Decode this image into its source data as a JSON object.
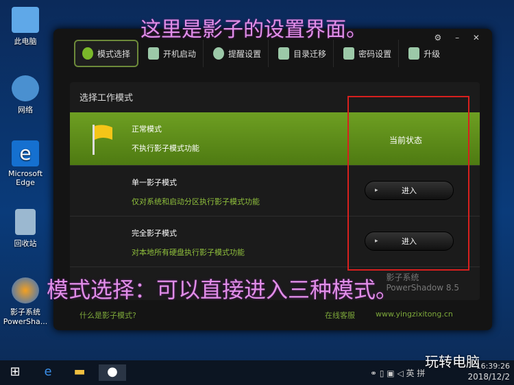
{
  "desktop": [
    {
      "label": "此电脑"
    },
    {
      "label": "网络"
    },
    {
      "label": "Microsoft Edge"
    },
    {
      "label": "回收站"
    },
    {
      "label": "影子系统 PowerSha..."
    }
  ],
  "annotations": {
    "top": "这里是影子的设置界面。",
    "middle": "模式选择：可以直接进入三种模式。"
  },
  "window": {
    "controls": "⚙ – ✕",
    "tabs": [
      {
        "label": "模式选择",
        "active": true
      },
      {
        "label": "开机启动"
      },
      {
        "label": "提醒设置"
      },
      {
        "label": "目录迁移"
      },
      {
        "label": "密码设置"
      },
      {
        "label": "升级"
      }
    ],
    "panel_title": "选择工作模式",
    "modes": [
      {
        "name": "正常模式",
        "desc": "不执行影子模式功能",
        "status": "当前状态"
      },
      {
        "name": "单一影子模式",
        "desc": "仅对系统和启动分区执行影子模式功能",
        "button": "进入"
      },
      {
        "name": "完全影子模式",
        "desc": "对本地所有硬盘执行影子模式功能",
        "button": "进入"
      }
    ],
    "brand": {
      "cn": "影子系统",
      "en": "PowerShadow",
      "version": "8.5"
    },
    "footer": {
      "help": "什么是影子模式?",
      "support": "在线客服",
      "site": "www.yingzixitong.cn"
    }
  },
  "watermark": "玩转电脑",
  "tray": {
    "ime": "英",
    "ime2": "拼",
    "time": "16:39:26",
    "date": "2018/12/2"
  },
  "colors": {
    "accent": "#6e9f22",
    "highlight": "#d8201e",
    "annotation": "#e18ee8"
  }
}
